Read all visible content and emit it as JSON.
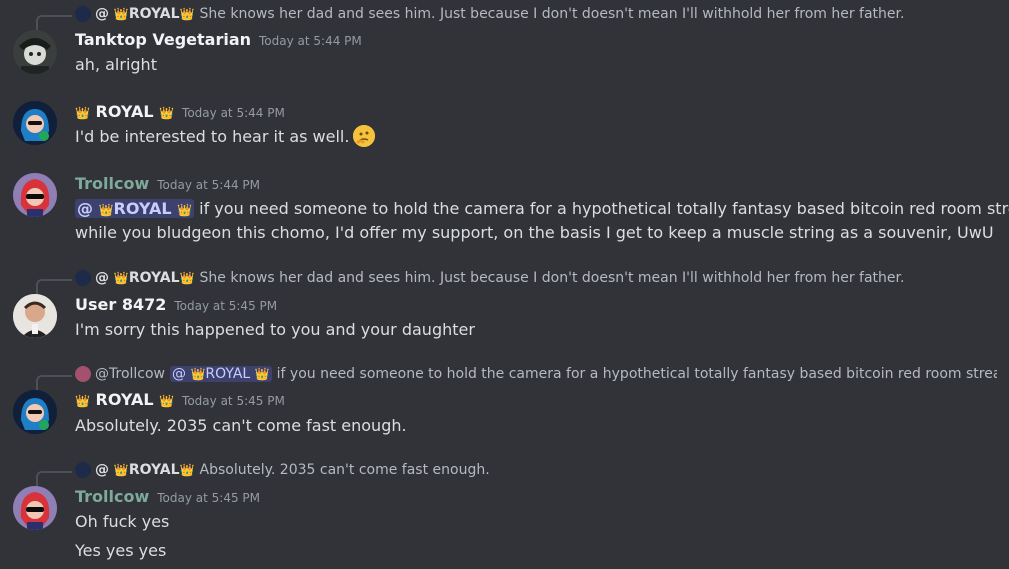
{
  "crown": "👑",
  "thinking_emoji": "🤔",
  "messages": [
    {
      "reply": {
        "prefix": "@",
        "name": "ROYAL",
        "text": "She knows her dad and sees him. Just because I don't doesn't mean I'll withhold her from her father."
      },
      "author": "Tanktop Vegetarian",
      "timestamp": "Today at 5:44 PM",
      "lines": [
        "ah, alright"
      ]
    },
    {
      "author": "ROYAL",
      "timestamp": "Today at 5:44 PM",
      "lines": [
        "I'd be interested to hear it as well."
      ]
    },
    {
      "author": "Trollcow",
      "timestamp": "Today at 5:44 PM",
      "mention": "@",
      "mention_name": "ROYAL",
      "lines": [
        "if you need someone to hold the camera for a hypothetical totally fantasy based bitcoin red room stream",
        "while you bludgeon this chomo, I'd offer my support, on the basis I get to keep a muscle string as a souvenir, UwU"
      ]
    },
    {
      "reply": {
        "prefix": "@",
        "name": "ROYAL",
        "text": "She knows her dad and sees him. Just because I don't doesn't mean I'll withhold her from her father."
      },
      "author": "User 8472",
      "timestamp": "Today at 5:45 PM",
      "lines": [
        "I'm sorry this happened to you and your daughter"
      ]
    },
    {
      "reply": {
        "prefix": "@Trollcow",
        "mention": "@",
        "name": "ROYAL",
        "text": "if you need someone to hold the camera for a hypothetical totally fantasy based bitcoin red room stream whi"
      },
      "author": "ROYAL",
      "timestamp": "Today at 5:45 PM",
      "lines": [
        "Absolutely. 2035 can't come fast enough."
      ]
    },
    {
      "reply": {
        "prefix": "@",
        "name": "ROYAL",
        "text": "Absolutely. 2035 can't come fast enough."
      },
      "author": "Trollcow",
      "timestamp": "Today at 5:45 PM",
      "lines": [
        "Oh fuck yes",
        "Yes yes yes"
      ]
    }
  ]
}
